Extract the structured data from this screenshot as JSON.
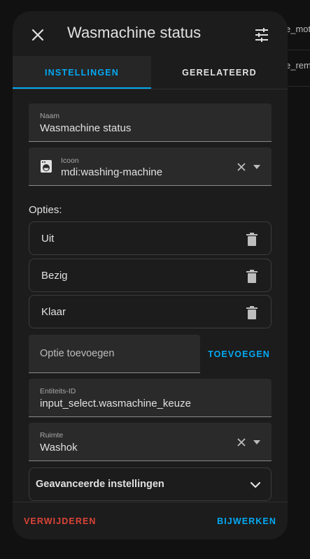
{
  "background": {
    "rows": [
      "e_mot",
      "e_rem"
    ]
  },
  "dialog": {
    "title": "Wasmachine status",
    "tabs": [
      {
        "label": "INSTELLINGEN",
        "active": true
      },
      {
        "label": "GERELATEERD",
        "active": false
      }
    ],
    "name_field": {
      "label": "Naam",
      "value": "Wasmachine status"
    },
    "icon_field": {
      "label": "Icoon",
      "value": "mdi:washing-machine"
    },
    "options_heading": "Opties:",
    "options": [
      "Uit",
      "Bezig",
      "Klaar"
    ],
    "add_option": {
      "placeholder": "Optie toevoegen",
      "button_label": "TOEVOEGEN"
    },
    "entity_field": {
      "label": "Entiteits-ID",
      "value": "input_select.wasmachine_keuze"
    },
    "area_field": {
      "label": "Ruimte",
      "value": "Washok"
    },
    "advanced_label": "Geavanceerde instellingen",
    "footer": {
      "delete_label": "VERWIJDEREN",
      "update_label": "BIJWERKEN"
    }
  },
  "colors": {
    "accent": "#03a9f4",
    "danger": "#db4437",
    "surface": "#1c1c1c",
    "field": "#2a2a2a"
  }
}
